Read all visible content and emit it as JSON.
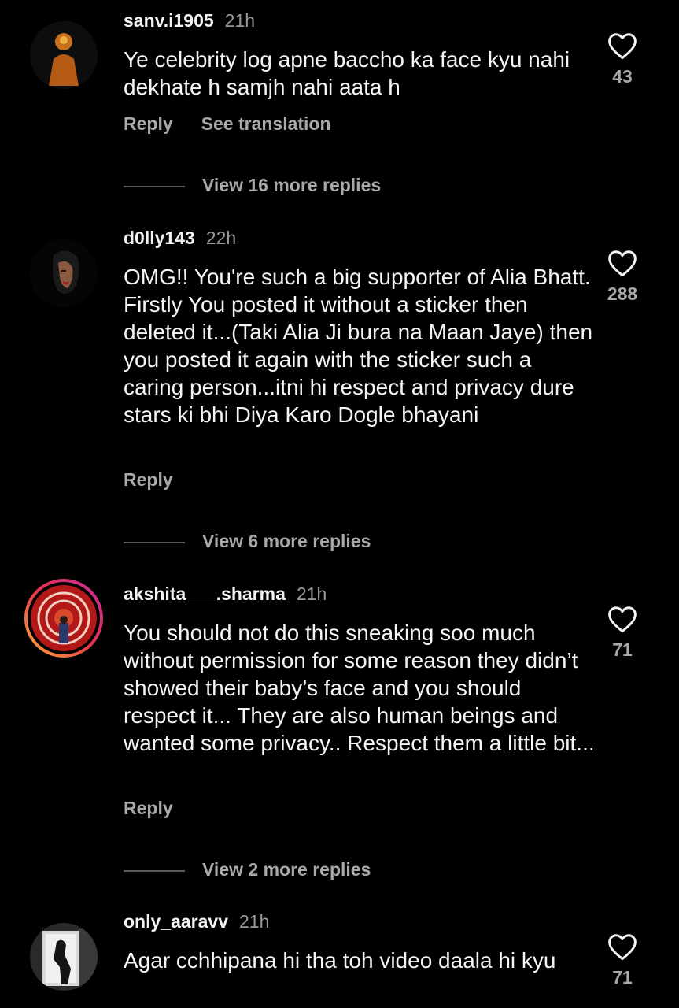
{
  "comments": [
    {
      "username": "sanv.i1905",
      "time": "21h",
      "text": "Ye celebrity log apne baccho ka face kyu nahi dekhate h samjh nahi aata h",
      "likes": "43",
      "reply_label": "Reply",
      "translate_label": "See translation",
      "view_replies": "View 16 more replies"
    },
    {
      "username": "d0lly143",
      "time": "22h",
      "text": "OMG!! You're such a big supporter of Alia Bhatt. Firstly You posted it without a sticker then deleted it...(Taki Alia Ji bura na Maan Jaye) then you posted it again with the sticker such a caring person...itni hi respect and privacy dure stars ki bhi Diya Karo Dogle bhayani",
      "likes": "288",
      "reply_label": "Reply",
      "view_replies": "View 6 more replies"
    },
    {
      "username": "akshita___.sharma",
      "time": "21h",
      "text": "You should not do this sneaking soo much without permission for some reason they didn’t showed their baby’s face and you should respect it... They are also human beings and wanted some privacy.. Respect them a little bit...",
      "likes": "71",
      "reply_label": "Reply",
      "view_replies": "View 2 more replies"
    },
    {
      "username": "only_aaravv",
      "time": "21h",
      "text": "Agar cchhipana hi tha toh video daala hi kyu",
      "likes": "71"
    }
  ]
}
